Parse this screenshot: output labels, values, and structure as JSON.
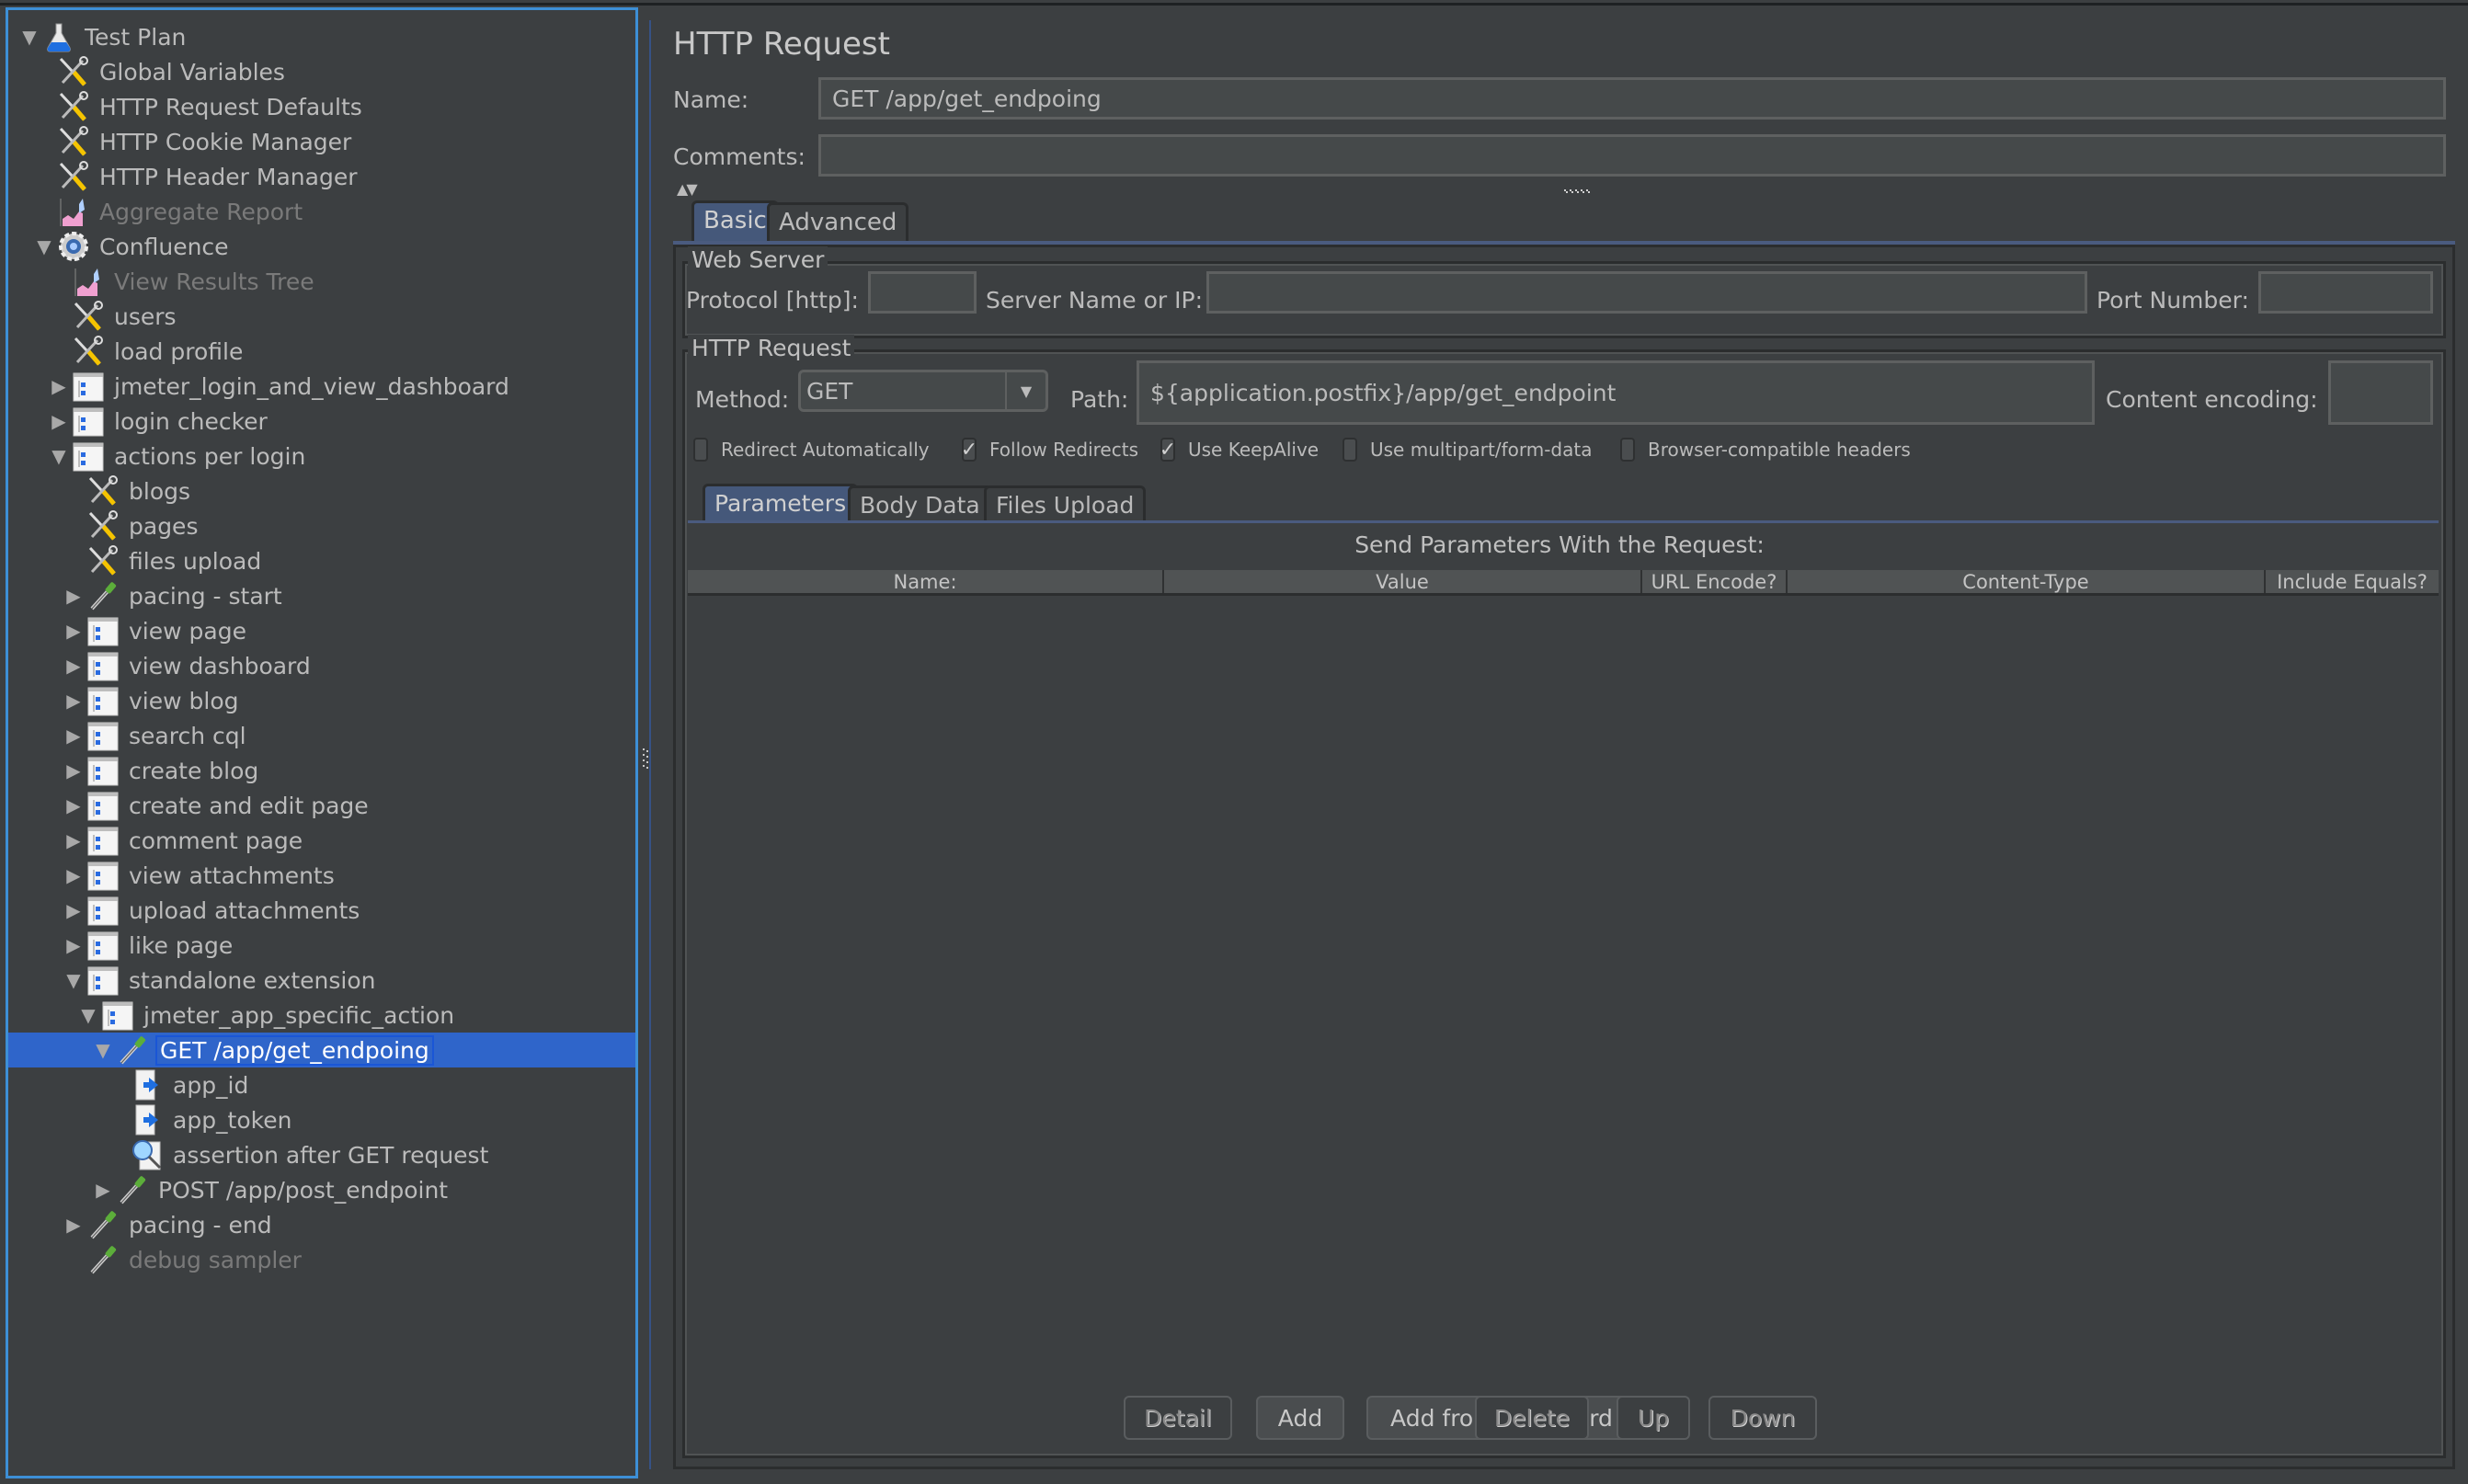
{
  "tree": {
    "items": [
      {
        "label": "Test Plan",
        "icon": "flask-icon",
        "toggle": "expanded",
        "disabled": false,
        "selected": false
      },
      {
        "label": "Global Variables",
        "icon": "config-tools-icon",
        "toggle": "none",
        "disabled": false,
        "selected": false
      },
      {
        "label": "HTTP Request Defaults",
        "icon": "config-tools-icon",
        "toggle": "none",
        "disabled": false,
        "selected": false
      },
      {
        "label": "HTTP Cookie Manager",
        "icon": "config-tools-icon",
        "toggle": "none",
        "disabled": false,
        "selected": false
      },
      {
        "label": "HTTP Header Manager",
        "icon": "config-tools-icon",
        "toggle": "none",
        "disabled": false,
        "selected": false
      },
      {
        "label": "Aggregate Report",
        "icon": "listener-chart-icon",
        "toggle": "none",
        "disabled": true,
        "selected": false
      },
      {
        "label": "Confluence",
        "icon": "thread-group-gear-icon",
        "toggle": "expanded",
        "disabled": false,
        "selected": false
      },
      {
        "label": "View Results Tree",
        "icon": "listener-chart-icon",
        "toggle": "none",
        "disabled": true,
        "selected": false
      },
      {
        "label": "users",
        "icon": "config-tools-icon",
        "toggle": "none",
        "disabled": false,
        "selected": false
      },
      {
        "label": "load profile",
        "icon": "config-tools-icon",
        "toggle": "none",
        "disabled": false,
        "selected": false
      },
      {
        "label": "jmeter_login_and_view_dashboard",
        "icon": "controller-icon",
        "toggle": "collapsed",
        "disabled": false,
        "selected": false
      },
      {
        "label": "login checker",
        "icon": "controller-icon",
        "toggle": "collapsed",
        "disabled": false,
        "selected": false
      },
      {
        "label": "actions per login",
        "icon": "controller-icon",
        "toggle": "expanded",
        "disabled": false,
        "selected": false
      },
      {
        "label": "blogs",
        "icon": "config-tools-icon",
        "toggle": "none",
        "disabled": false,
        "selected": false
      },
      {
        "label": "pages",
        "icon": "config-tools-icon",
        "toggle": "none",
        "disabled": false,
        "selected": false
      },
      {
        "label": "files upload",
        "icon": "config-tools-icon",
        "toggle": "none",
        "disabled": false,
        "selected": false
      },
      {
        "label": "pacing - start",
        "icon": "sampler-pipette-icon",
        "toggle": "collapsed",
        "disabled": false,
        "selected": false
      },
      {
        "label": "view page",
        "icon": "controller-icon",
        "toggle": "collapsed",
        "disabled": false,
        "selected": false
      },
      {
        "label": "view dashboard",
        "icon": "controller-icon",
        "toggle": "collapsed",
        "disabled": false,
        "selected": false
      },
      {
        "label": "view blog",
        "icon": "controller-icon",
        "toggle": "collapsed",
        "disabled": false,
        "selected": false
      },
      {
        "label": "search cql",
        "icon": "controller-icon",
        "toggle": "collapsed",
        "disabled": false,
        "selected": false
      },
      {
        "label": "create blog",
        "icon": "controller-icon",
        "toggle": "collapsed",
        "disabled": false,
        "selected": false
      },
      {
        "label": "create and edit page",
        "icon": "controller-icon",
        "toggle": "collapsed",
        "disabled": false,
        "selected": false
      },
      {
        "label": "comment page",
        "icon": "controller-icon",
        "toggle": "collapsed",
        "disabled": false,
        "selected": false
      },
      {
        "label": "view attachments",
        "icon": "controller-icon",
        "toggle": "collapsed",
        "disabled": false,
        "selected": false
      },
      {
        "label": "upload attachments",
        "icon": "controller-icon",
        "toggle": "collapsed",
        "disabled": false,
        "selected": false
      },
      {
        "label": "like page",
        "icon": "controller-icon",
        "toggle": "collapsed",
        "disabled": false,
        "selected": false
      },
      {
        "label": "standalone extension",
        "icon": "controller-icon",
        "toggle": "expanded",
        "disabled": false,
        "selected": false
      },
      {
        "label": "jmeter_app_specific_action",
        "icon": "controller-icon",
        "toggle": "expanded",
        "disabled": false,
        "selected": false
      },
      {
        "label": "GET /app/get_endpoing",
        "icon": "sampler-pipette-icon",
        "toggle": "expanded",
        "disabled": false,
        "selected": true
      },
      {
        "label": "app_id",
        "icon": "extractor-arrow-icon",
        "toggle": "none",
        "disabled": false,
        "selected": false
      },
      {
        "label": "app_token",
        "icon": "extractor-arrow-icon",
        "toggle": "none",
        "disabled": false,
        "selected": false
      },
      {
        "label": "assertion after GET request",
        "icon": "assertion-magnifier-icon",
        "toggle": "none",
        "disabled": false,
        "selected": false
      },
      {
        "label": "POST /app/post_endpoint",
        "icon": "sampler-pipette-icon",
        "toggle": "collapsed",
        "disabled": false,
        "selected": false
      },
      {
        "label": "pacing - end",
        "icon": "sampler-pipette-icon",
        "toggle": "collapsed",
        "disabled": false,
        "selected": false
      },
      {
        "label": "debug sampler",
        "icon": "sampler-pipette-icon",
        "toggle": "none",
        "disabled": true,
        "selected": false
      }
    ]
  },
  "panel": {
    "title": "HTTP Request",
    "name_label": "Name:",
    "name_value": "GET /app/get_endpoing",
    "comments_label": "Comments:",
    "comments_value": "",
    "tabs": [
      {
        "label": "Basic",
        "active": true
      },
      {
        "label": "Advanced",
        "active": false
      }
    ],
    "web_server": {
      "title": "Web Server",
      "protocol_label": "Protocol [http]:",
      "protocol_value": "",
      "server_label": "Server Name or IP:",
      "server_value": "",
      "port_label": "Port Number:",
      "port_value": ""
    },
    "http_request": {
      "title": "HTTP Request",
      "method_label": "Method:",
      "method_value": "GET",
      "path_label": "Path:",
      "path_value": "${application.postfix}/app/get_endpoint",
      "encoding_label": "Content encoding:",
      "encoding_value": "",
      "checkboxes": [
        {
          "label": "Redirect Automatically",
          "checked": false
        },
        {
          "label": "Follow Redirects",
          "checked": true
        },
        {
          "label": "Use KeepAlive",
          "checked": true
        },
        {
          "label": "Use multipart/form-data",
          "checked": false
        },
        {
          "label": "Browser-compatible headers",
          "checked": false
        }
      ]
    },
    "subtabs": [
      {
        "label": "Parameters",
        "active": true
      },
      {
        "label": "Body Data",
        "active": false
      },
      {
        "label": "Files Upload",
        "active": false
      }
    ],
    "params_caption": "Send Parameters With the Request:",
    "params_columns": [
      "Name:",
      "Value",
      "URL Encode?",
      "Content-Type",
      "Include Equals?"
    ],
    "params_rows": [],
    "buttons": [
      {
        "label": "Detail",
        "enabled": false
      },
      {
        "label": "Add",
        "enabled": true
      },
      {
        "label": "Add from Clipboard",
        "enabled": true
      },
      {
        "label": "Delete",
        "enabled": false
      },
      {
        "label": "Up",
        "enabled": false
      },
      {
        "label": "Down",
        "enabled": false
      }
    ]
  },
  "colors": {
    "background": "#3c3f41",
    "selection": "#2f65ca",
    "tree_border": "#3d8fd6",
    "active_tab": "#45587a"
  }
}
